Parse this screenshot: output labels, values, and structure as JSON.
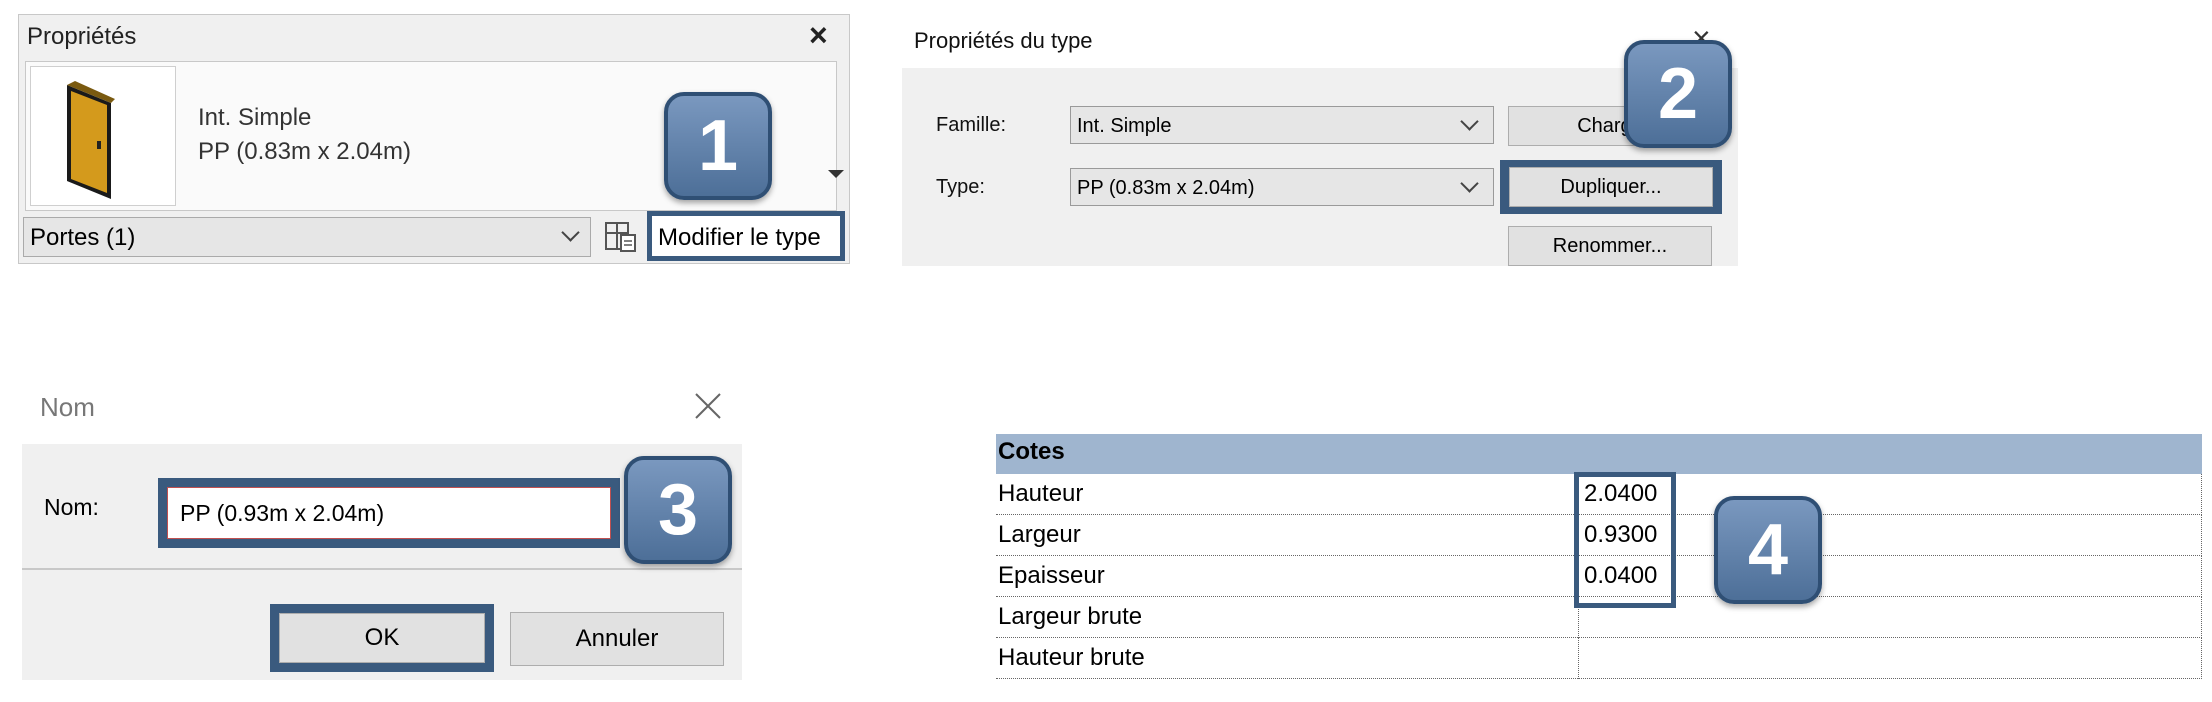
{
  "properties_panel": {
    "title": "Propriétés",
    "close_icon": "×",
    "family_name": "Int. Simple",
    "type_name": "PP (0.83m x 2.04m)",
    "category_select": "Portes (1)",
    "edit_type_label": "Modifier le type"
  },
  "type_properties": {
    "title": "Propriétés du type",
    "close_icon": "×",
    "family_label": "Famille:",
    "family_value": "Int. Simple",
    "type_label": "Type:",
    "type_value": "PP (0.83m x 2.04m)",
    "load_button": "Charge",
    "duplicate_button": "Dupliquer...",
    "rename_button": "Renommer..."
  },
  "name_dialog": {
    "title": "Nom",
    "name_label": "Nom:",
    "name_value": "PP (0.93m x 2.04m)",
    "ok_button": "OK",
    "cancel_button": "Annuler"
  },
  "dimensions_table": {
    "header": "Cotes",
    "rows": [
      {
        "label": "Hauteur",
        "value": "2.0400"
      },
      {
        "label": "Largeur",
        "value": "0.9300"
      },
      {
        "label": "Epaisseur",
        "value": "0.0400"
      },
      {
        "label": "Largeur brute",
        "value": ""
      },
      {
        "label": "Hauteur brute",
        "value": ""
      }
    ]
  },
  "steps": [
    "1",
    "2",
    "3",
    "4"
  ],
  "colors": {
    "highlight_border": "#3a5a7e",
    "badge_fill": "#5f80aa",
    "table_header": "#9fb5cf",
    "door_fill": "#d49a1c"
  }
}
